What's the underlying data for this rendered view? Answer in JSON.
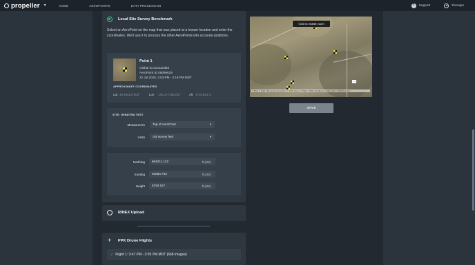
{
  "topbar": {
    "brand": "propeller",
    "nav": [
      "HOME",
      "AEROPOINTS",
      "DATA PROCESSING"
    ],
    "support_label": "Support",
    "user_label": "Ronalyn"
  },
  "survey_card": {
    "title": "Local Site Survey Benchmark",
    "description": "Select an AeroPoint on the map that was placed at a known location and enter the coordinates. We'll use it to process the other AeroPoints into accurate positions.",
    "point": {
      "title": "Point 1",
      "global_id": "Global ID ac41aed50",
      "aeropoint_id": "AeroPoint ID 08099029",
      "date": "22 Jul 2020, 2:03 PM - 4:19 PM MDT",
      "approx_label": "APPROXIMATE COORDINATES",
      "lat_label": "Lat",
      "lat_value": "39.450127802°",
      "lon_label": "Lon",
      "lon_value": "-105.177490101°",
      "alt_label": "Alt",
      "alt_value": "1746.814 m"
    },
    "site": {
      "label": "SITE: WINDTRA TEST",
      "measured_label": "Measured to",
      "measured_value": "Top of AeroPoint",
      "units_label": "Units",
      "units_value": "US survey feet"
    },
    "coords": {
      "northing_label": "Northing",
      "northing_value": "664211.122",
      "easting_label": "Easting",
      "easting_value": "91684.793",
      "height_label": "Height",
      "height_value": "5793.167",
      "unit": "ft (US)"
    }
  },
  "rinex_card": {
    "title": "RINEX Upload"
  },
  "ppk_card": {
    "title": "PPK Drone Flights",
    "flight": "Flight 1: 3:47 PM - 3:59 PM MDT (668 images)"
  },
  "map": {
    "zoom_tip": "Click to enable zoom",
    "attribution": "© Bing © 2021 Microsoft Corporation © 2021 Maxar ©CNES (2021) Distribution Airbus DS © 2021 TomTom",
    "control": "+"
  },
  "save_label": "SAVE",
  "icons": {
    "help": "help-circle-icon",
    "user": "user-icon",
    "check": "check-icon",
    "plus": "plus-icon",
    "caret": "chevron-down-icon"
  },
  "colors": {
    "accent": "#2ec27e",
    "save_disabled": "#7b848d"
  }
}
